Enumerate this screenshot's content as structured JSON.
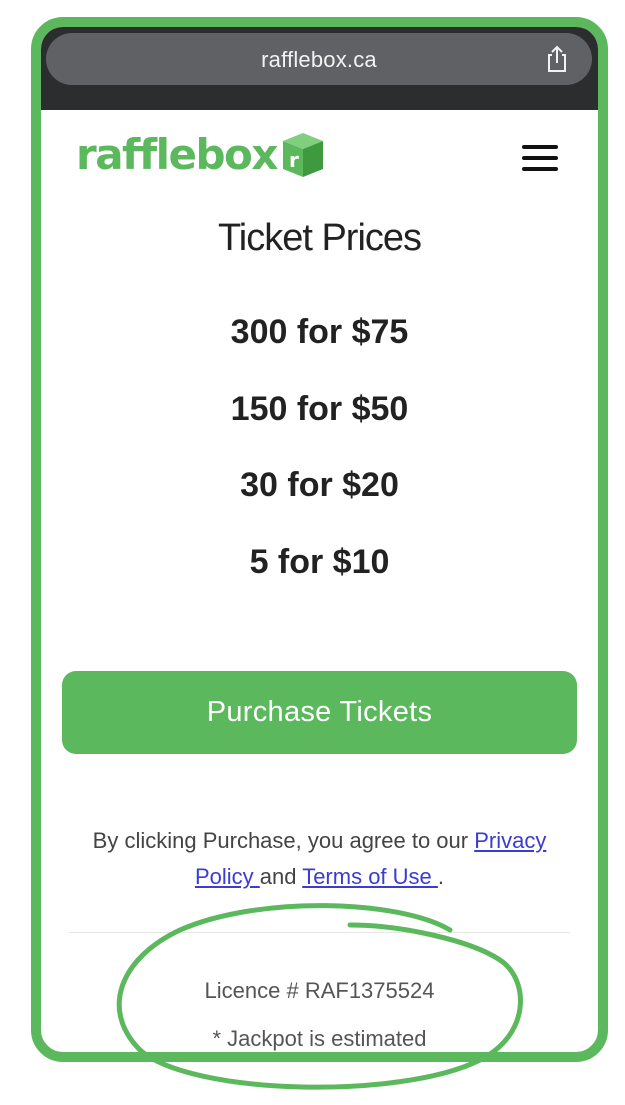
{
  "browser": {
    "url": "rafflebox.ca",
    "share_icon": "share-icon"
  },
  "header": {
    "logo_text": "rafflebox",
    "logo_box_letter": "r",
    "menu_icon": "hamburger-menu-icon"
  },
  "main": {
    "title": "Ticket Prices",
    "prices": [
      "300 for $75",
      "150 for $50",
      "30 for $20",
      "5 for $10"
    ],
    "purchase_button": "Purchase Tickets",
    "agreement": {
      "prefix": "By clicking Purchase, you agree to our ",
      "privacy_link": "Privacy Policy ",
      "middle": "and ",
      "terms_link": "Terms of Use ",
      "suffix": "."
    },
    "licence": "Licence # RAF1375524",
    "jackpot_note": "* Jackpot is estimated"
  },
  "colors": {
    "brand_green": "#5cb85c",
    "browser_bar": "#2b2d2f",
    "link": "#3b3bd6"
  }
}
